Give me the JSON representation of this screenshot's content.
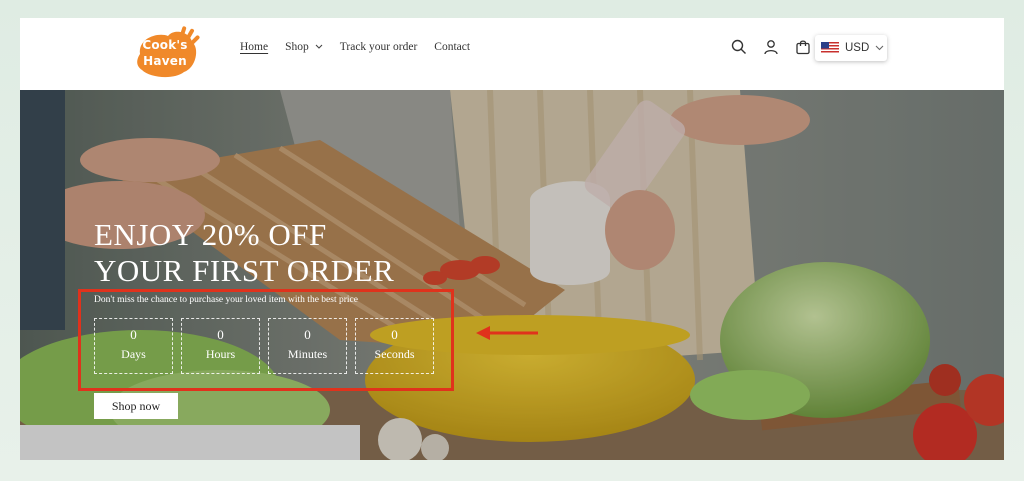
{
  "header": {
    "logo_line1": "Cook's",
    "logo_line2": "Haven",
    "nav": [
      {
        "label": "Home"
      },
      {
        "label": "Shop"
      },
      {
        "label": "Track your order"
      },
      {
        "label": "Contact"
      }
    ],
    "currency": "USD",
    "icons": [
      "search-icon",
      "account-icon",
      "cart-icon"
    ]
  },
  "hero": {
    "title_line1": "ENJOY 20% OFF",
    "title_line2": "YOUR FIRST ORDER",
    "subtitle": "Don't miss the chance to purchase your loved item with the best price",
    "countdown": [
      {
        "value": "0",
        "label": "Days"
      },
      {
        "value": "0",
        "label": "Hours"
      },
      {
        "value": "0",
        "label": "Minutes"
      },
      {
        "value": "0",
        "label": "Seconds"
      }
    ],
    "cta": "Shop now"
  },
  "colors": {
    "annotation": "#e0321c",
    "logo_orange": "#f0892a"
  }
}
